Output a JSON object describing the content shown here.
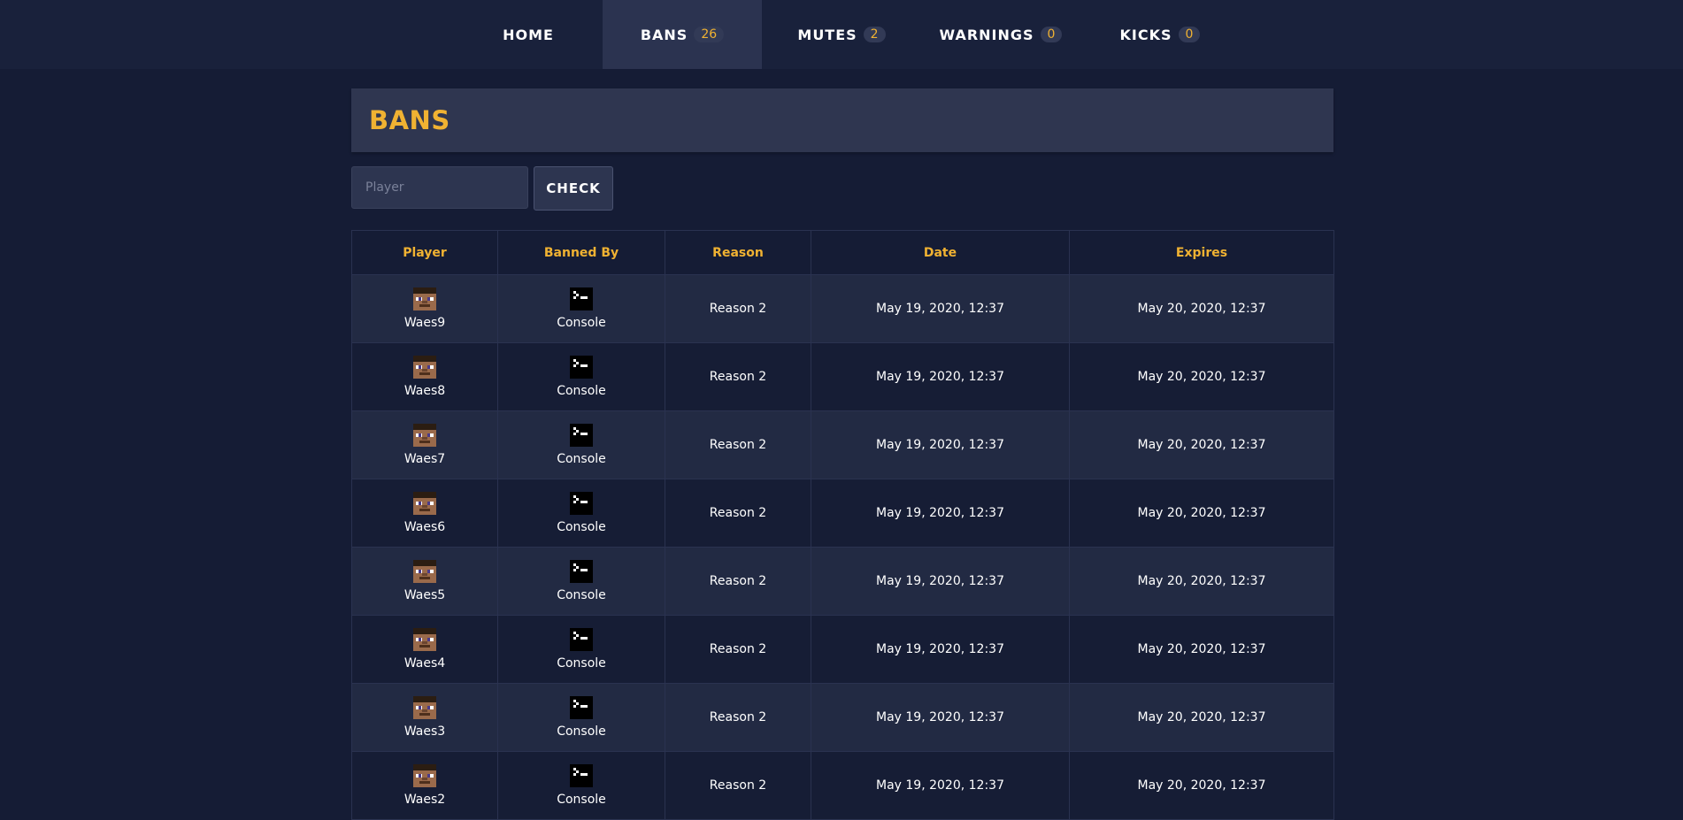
{
  "nav": {
    "items": [
      {
        "label": "HOME",
        "badge": null
      },
      {
        "label": "BANS",
        "badge": "26"
      },
      {
        "label": "MUTES",
        "badge": "2"
      },
      {
        "label": "WARNINGS",
        "badge": "0"
      },
      {
        "label": "KICKS",
        "badge": "0"
      }
    ],
    "active": "BANS"
  },
  "page": {
    "title": "BANS"
  },
  "search": {
    "placeholder": "Player",
    "value": "",
    "button_label": "CHECK"
  },
  "table": {
    "headers": {
      "player": "Player",
      "banned_by": "Banned By",
      "reason": "Reason",
      "date": "Date",
      "expires": "Expires"
    },
    "rows": [
      {
        "player": "Waes9",
        "banned_by": "Console",
        "reason": "Reason 2",
        "date": "May 19, 2020, 12:37",
        "expires": "May 20, 2020, 12:37"
      },
      {
        "player": "Waes8",
        "banned_by": "Console",
        "reason": "Reason 2",
        "date": "May 19, 2020, 12:37",
        "expires": "May 20, 2020, 12:37"
      },
      {
        "player": "Waes7",
        "banned_by": "Console",
        "reason": "Reason 2",
        "date": "May 19, 2020, 12:37",
        "expires": "May 20, 2020, 12:37"
      },
      {
        "player": "Waes6",
        "banned_by": "Console",
        "reason": "Reason 2",
        "date": "May 19, 2020, 12:37",
        "expires": "May 20, 2020, 12:37"
      },
      {
        "player": "Waes5",
        "banned_by": "Console",
        "reason": "Reason 2",
        "date": "May 19, 2020, 12:37",
        "expires": "May 20, 2020, 12:37"
      },
      {
        "player": "Waes4",
        "banned_by": "Console",
        "reason": "Reason 2",
        "date": "May 19, 2020, 12:37",
        "expires": "May 20, 2020, 12:37"
      },
      {
        "player": "Waes3",
        "banned_by": "Console",
        "reason": "Reason 2",
        "date": "May 19, 2020, 12:37",
        "expires": "May 20, 2020, 12:37"
      },
      {
        "player": "Waes2",
        "banned_by": "Console",
        "reason": "Reason 2",
        "date": "May 19, 2020, 12:37",
        "expires": "May 20, 2020, 12:37"
      }
    ]
  },
  "icons": {
    "player_avatar": "steve-head-icon",
    "console_avatar": "console-terminal-icon"
  },
  "colors": {
    "accent": "#f0b232",
    "background": "#151c35",
    "nav_background": "#19213b",
    "nav_active": "#2b3350",
    "header_panel": "#2f3650",
    "row_odd": "#222a43",
    "row_even": "#161d35"
  }
}
